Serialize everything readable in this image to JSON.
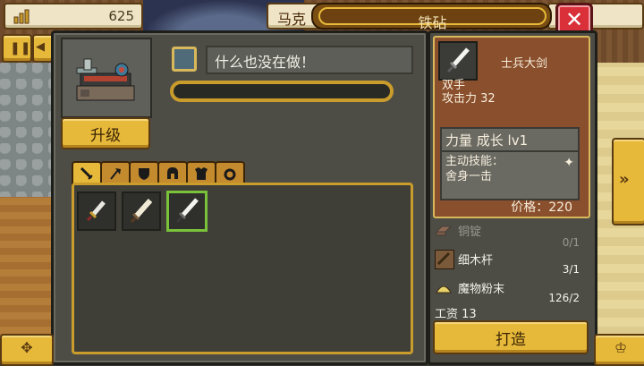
{
  "header": {
    "money": "625",
    "character_name": "马克",
    "title": "铁砧",
    "close_icon": "close-icon"
  },
  "workshop": {
    "upgrade_label": "升级",
    "status": "什么也没在做！",
    "progress": 0.0
  },
  "tabs": [
    {
      "icon": "sword-icon",
      "active": true
    },
    {
      "icon": "axe-icon",
      "active": false
    },
    {
      "icon": "shield-icon",
      "active": false
    },
    {
      "icon": "helmet-icon",
      "active": false
    },
    {
      "icon": "armor-icon",
      "active": false
    },
    {
      "icon": "ring-icon",
      "active": false
    }
  ],
  "items": [
    {
      "icon": "dagger-icon",
      "selected": false
    },
    {
      "icon": "short-sword-icon",
      "selected": false
    },
    {
      "icon": "broadsword-icon",
      "selected": true
    }
  ],
  "detail": {
    "name": "士兵大剑",
    "type_line1": "双手",
    "type_line2": "攻击力 32",
    "stat": "力量 成长 lv1",
    "skill_line1": "主动技能：",
    "skill_line2": "舍身一击",
    "price": "价格：220"
  },
  "materials": [
    {
      "name": "铜锭",
      "count": "",
      "dim": true,
      "icon": "ingot-icon"
    },
    {
      "name": "",
      "count": "0/1",
      "dim": true,
      "icon": ""
    },
    {
      "name": "细木杆",
      "count": "3/1",
      "dim": false,
      "icon": "stick-icon"
    },
    {
      "name": "魔物粉末",
      "count": "126/2",
      "dim": false,
      "icon": "powder-icon"
    }
  ],
  "wage": "工资 13",
  "forge_label": "打造",
  "colors": {
    "accent": "#e7b93a",
    "panel": "#4d4d45",
    "card": "#8a4f2c",
    "close": "#d9303a"
  }
}
